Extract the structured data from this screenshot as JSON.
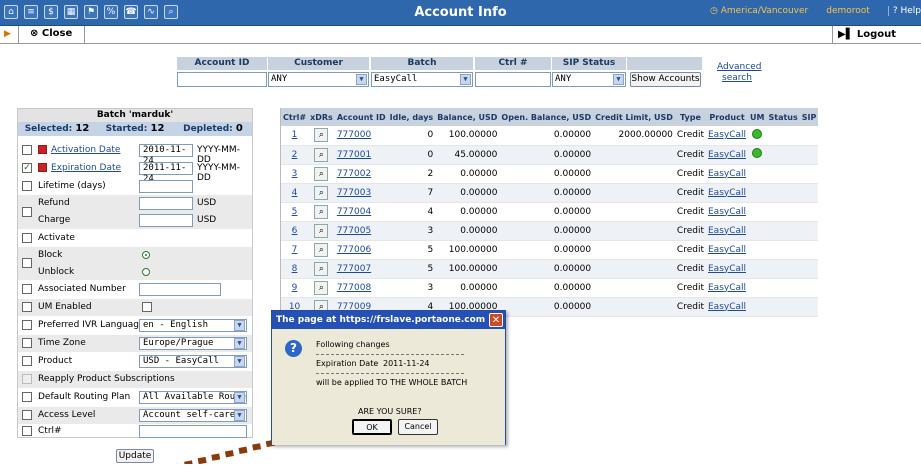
{
  "topbar": {
    "title": "Account Info",
    "timezone": "America/Vancouver",
    "user": "demoroot",
    "help": "Help",
    "icons": [
      "home-icon",
      "list-icon",
      "dollar-icon",
      "grid-icon",
      "flag-icon",
      "percent-icon",
      "phone-icon",
      "chart-icon",
      "search-icon"
    ]
  },
  "toolbar": {
    "close_label": "Close",
    "logout_label": "Logout"
  },
  "search": {
    "headers": [
      "Account ID",
      "Customer",
      "Batch",
      "Ctrl #",
      "SIP Status"
    ],
    "customer_value": "ANY",
    "batch_value": "EasyCall",
    "sip_value": "ANY",
    "show_button": "Show Accounts",
    "advanced_line1": "Advanced",
    "advanced_line2": "search"
  },
  "batch": {
    "title": "Batch 'marduk'",
    "selected_label": "Selected:",
    "selected_value": "12",
    "started_label": "Started:",
    "started_value": "12",
    "depleted_label": "Depleted:",
    "depleted_value": "0",
    "activation_label": "Activation Date",
    "activation_value": "2010-11-24",
    "date_format": "YYYY-MM-DD",
    "expiration_label": "Expiration Date",
    "expiration_value": "2011-11-24",
    "lifetime_label": "Lifetime (days)",
    "refund_label": "Refund",
    "charge_label": "Charge",
    "currency": "USD",
    "activate_label": "Activate",
    "block_label": "Block",
    "unblock_label": "Unblock",
    "associated_label": "Associated Number",
    "um_label": "UM Enabled",
    "ivr_label": "Preferred IVR Language",
    "ivr_value": "en - English",
    "tz_label": "Time Zone",
    "tz_value": "Europe/Prague",
    "product_label": "Product",
    "product_value": "USD - EasyCall",
    "reapply_label": "Reapply Product Subscriptions",
    "routing_label": "Default Routing Plan",
    "routing_value": "All Available Route",
    "access_label": "Access Level",
    "access_value": "Account self-care",
    "ctrl_label": "Ctrl#",
    "update_label": "Update"
  },
  "table": {
    "headers": [
      "Ctrl#",
      "xDRs",
      "Account ID",
      "Idle, days",
      "Balance, USD",
      "Open. Balance, USD",
      "Credit Limit, USD",
      "Type",
      "Product",
      "UM",
      "Status",
      "SIP"
    ],
    "rows": [
      {
        "ctrl": "1",
        "id": "777000",
        "idle": "0",
        "balance": "100.00000",
        "open": "0.00000",
        "credit": "2000.00000",
        "type": "Credit",
        "product": "EasyCall",
        "um": true
      },
      {
        "ctrl": "2",
        "id": "777001",
        "idle": "0",
        "balance": "45.00000",
        "open": "0.00000",
        "credit": "",
        "type": "Credit",
        "product": "EasyCall",
        "um": true
      },
      {
        "ctrl": "3",
        "id": "777002",
        "idle": "2",
        "balance": "0.00000",
        "open": "0.00000",
        "credit": "",
        "type": "Credit",
        "product": "EasyCall",
        "um": false
      },
      {
        "ctrl": "4",
        "id": "777003",
        "idle": "7",
        "balance": "0.00000",
        "open": "0.00000",
        "credit": "",
        "type": "Credit",
        "product": "EasyCall",
        "um": false
      },
      {
        "ctrl": "5",
        "id": "777004",
        "idle": "4",
        "balance": "0.00000",
        "open": "0.00000",
        "credit": "",
        "type": "Credit",
        "product": "EasyCall",
        "um": false
      },
      {
        "ctrl": "6",
        "id": "777005",
        "idle": "3",
        "balance": "0.00000",
        "open": "0.00000",
        "credit": "",
        "type": "Credit",
        "product": "EasyCall",
        "um": false
      },
      {
        "ctrl": "7",
        "id": "777006",
        "idle": "5",
        "balance": "100.00000",
        "open": "0.00000",
        "credit": "",
        "type": "Credit",
        "product": "EasyCall",
        "um": false
      },
      {
        "ctrl": "8",
        "id": "777007",
        "idle": "5",
        "balance": "100.00000",
        "open": "0.00000",
        "credit": "",
        "type": "Credit",
        "product": "EasyCall",
        "um": false
      },
      {
        "ctrl": "9",
        "id": "777008",
        "idle": "3",
        "balance": "0.00000",
        "open": "0.00000",
        "credit": "",
        "type": "Credit",
        "product": "EasyCall",
        "um": false
      },
      {
        "ctrl": "10",
        "id": "777009",
        "idle": "4",
        "balance": "100.00000",
        "open": "0.00000",
        "credit": "",
        "type": "Credit",
        "product": "EasyCall",
        "um": false
      }
    ]
  },
  "dialog": {
    "title": "The page at https://frslave.portaone.com says:",
    "line1": "Following changes",
    "field_label": "Expiration Date",
    "field_value": "2011-11-24",
    "line3": "will be applied TO THE WHOLE BATCH",
    "question": "ARE YOU SURE?",
    "ok_label": "OK",
    "cancel_label": "Cancel"
  },
  "colors": {
    "topbar": "#2f67ad",
    "accent": "#1d4a9c",
    "highlight": "#c8d1de",
    "arrow": "#8b3a0e"
  }
}
